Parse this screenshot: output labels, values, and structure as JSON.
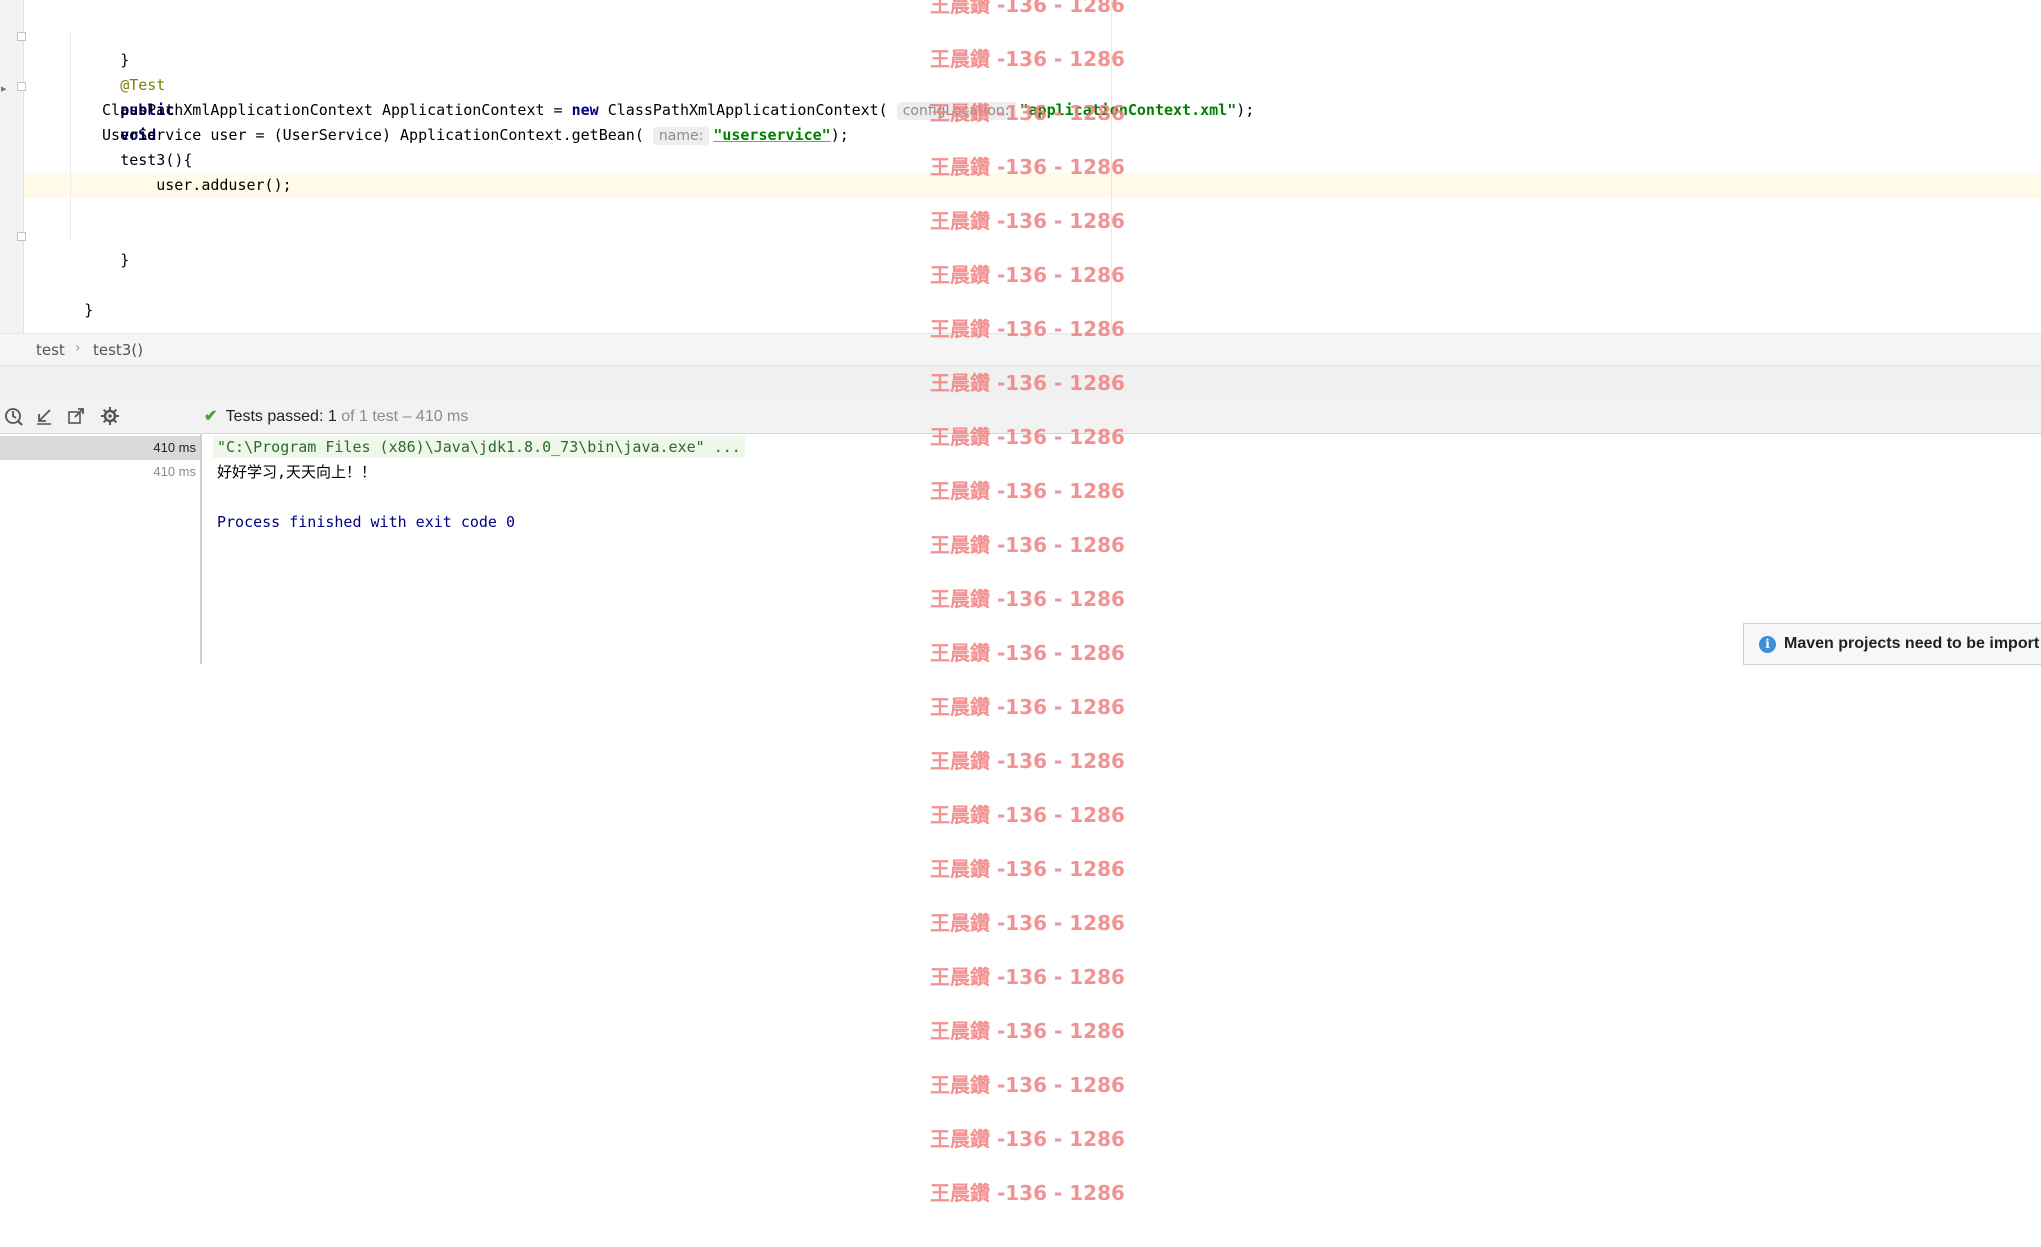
{
  "editor": {
    "lines": {
      "l1": "}",
      "l2_annotation": "@Test",
      "l3_kw1": "public",
      "l3_kw2": "void",
      "l3_rest": "test3(){",
      "l4_a": "ClassPathXmlApplicationContext ApplicationContext = ",
      "l4_new": "new",
      "l4_b": " ClassPathXmlApplicationContext(",
      "l4_hint": "configLocation:",
      "l4_str": "\"applicationContext.xml\"",
      "l4_end": ");",
      "l5_a": "UserService user = (UserService) ApplicationContext.getBean(",
      "l5_hint": "name:",
      "l5_str": "\"userservice\"",
      "l5_end": ");",
      "l6": "user.adduser();",
      "l8": "}",
      "l10": "}"
    }
  },
  "breadcrumb": {
    "items": [
      "test",
      "test3()"
    ],
    "separator": "›"
  },
  "run": {
    "toolbar": {
      "icons": [
        "history-icon",
        "import-tests-icon",
        "export-tests-icon",
        "settings-icon"
      ]
    },
    "status": {
      "check": "✔",
      "label": "Tests passed:",
      "count": "1",
      "detail": "of 1 test – 410 ms"
    },
    "tree": {
      "rows": [
        {
          "duration": "410 ms"
        },
        {
          "duration": "410 ms"
        }
      ]
    },
    "console": {
      "command": "\"C:\\Program Files (x86)\\Java\\jdk1.8.0_73\\bin\\java.exe\" ...",
      "output": "好好学习,天天向上！！",
      "exit": "Process finished with exit code 0"
    }
  },
  "notification": {
    "icon": "info-icon",
    "text": "Maven projects need to be import"
  },
  "watermark": {
    "text": "王晨鑽 -136 - 1286"
  },
  "colors": {
    "keyword": "#000080",
    "annotation": "#808000",
    "string": "#008000",
    "watermark": "#f08080",
    "success": "#4a9f3a"
  }
}
